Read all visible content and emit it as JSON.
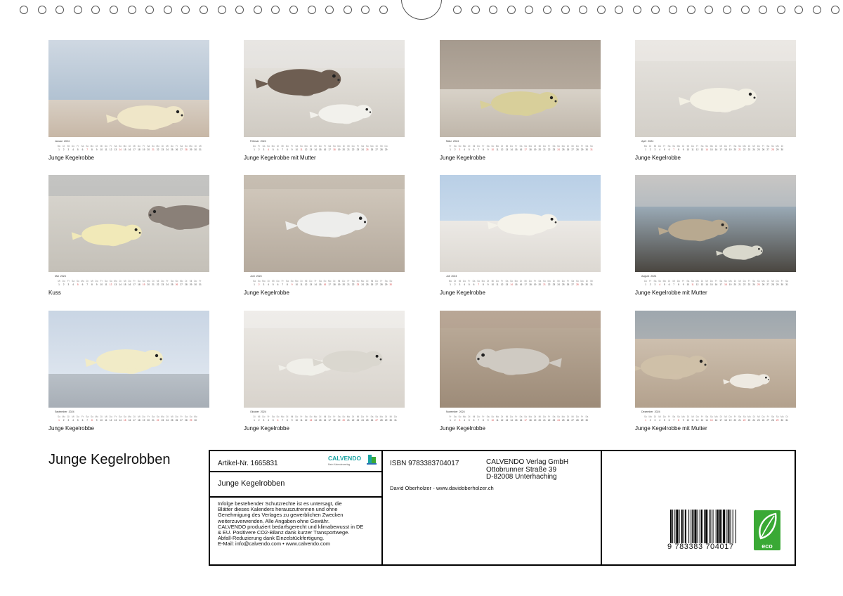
{
  "colors": {
    "sunday": "#d23c3c",
    "eco_green": "#3aa935",
    "calvendo_teal": "#1aa3a3"
  },
  "weekday_labels": [
    "Mo",
    "Di",
    "Mi",
    "Do",
    "Fr",
    "Sa",
    "So"
  ],
  "calendar": [
    {
      "month": "Januar",
      "year": "2024",
      "caption": "Junge Kegelrobbe",
      "start": 0,
      "days": 31
    },
    {
      "month": "Februar",
      "year": "2024",
      "caption": "Junge Kegelrobbe mit Mutter",
      "start": 3,
      "days": 29
    },
    {
      "month": "März",
      "year": "2024",
      "caption": "Junge Kegelrobbe",
      "start": 4,
      "days": 31
    },
    {
      "month": "April",
      "year": "2024",
      "caption": "Junge Kegelrobbe",
      "start": 0,
      "days": 30
    },
    {
      "month": "Mai",
      "year": "2024",
      "caption": "Kuss",
      "start": 2,
      "days": 31
    },
    {
      "month": "Juni",
      "year": "2024",
      "caption": "Junge Kegelrobbe",
      "start": 5,
      "days": 30
    },
    {
      "month": "Juli",
      "year": "2024",
      "caption": "Junge Kegelrobbe",
      "start": 0,
      "days": 31
    },
    {
      "month": "August",
      "year": "2024",
      "caption": "Junge Kegelrobbe mit Mutter",
      "start": 3,
      "days": 31
    },
    {
      "month": "September",
      "year": "2024",
      "caption": "Junge Kegelrobbe",
      "start": 6,
      "days": 30
    },
    {
      "month": "Oktober",
      "year": "2024",
      "caption": "Junge Kegelrobbe",
      "start": 1,
      "days": 31
    },
    {
      "month": "November",
      "year": "2024",
      "caption": "Junge Kegelrobbe",
      "start": 4,
      "days": 30
    },
    {
      "month": "Dezember",
      "year": "2024",
      "caption": "Junge Kegelrobbe mit Mutter",
      "start": 6,
      "days": 31
    }
  ],
  "title": "Junge Kegelrobben",
  "info": {
    "article": "Artikel-Nr. 1665831",
    "logo_name": "CALVENDO",
    "logo_tagline": "Mein Kalenderverlag",
    "calendar_title": "Junge Kegelrobben",
    "legal_lines": [
      "Infolge bestehender Schutzrechte ist es untersagt, die",
      "Blätter dieses Kalenders herauszutrennen und ohne",
      "Genehmigung des Verlages zu gewerblichen Zwecken",
      "weiterzuverwenden. Alle Angaben ohne Gewähr.",
      "CALVENDO produziert bedarfsgerecht und klimabewusst in DE",
      "& EU. Positivere CO2-Bilanz dank kurzer Transportwege.",
      "Abfall-Reduzierung dank Einzelstückfertigung.",
      "E-Mail: info@calvendo.com • www.calvendo.com"
    ],
    "isbn": "ISBN 9783383704017",
    "publisher_lines": [
      "CALVENDO Verlag GmbH",
      "Ottobrunner Straße 39",
      "D-82008 Unterhaching"
    ],
    "author": "David Oberholzer - www.davidoberholzer.ch",
    "barcode_number": "9   783383   704017",
    "eco_label": "eco"
  }
}
